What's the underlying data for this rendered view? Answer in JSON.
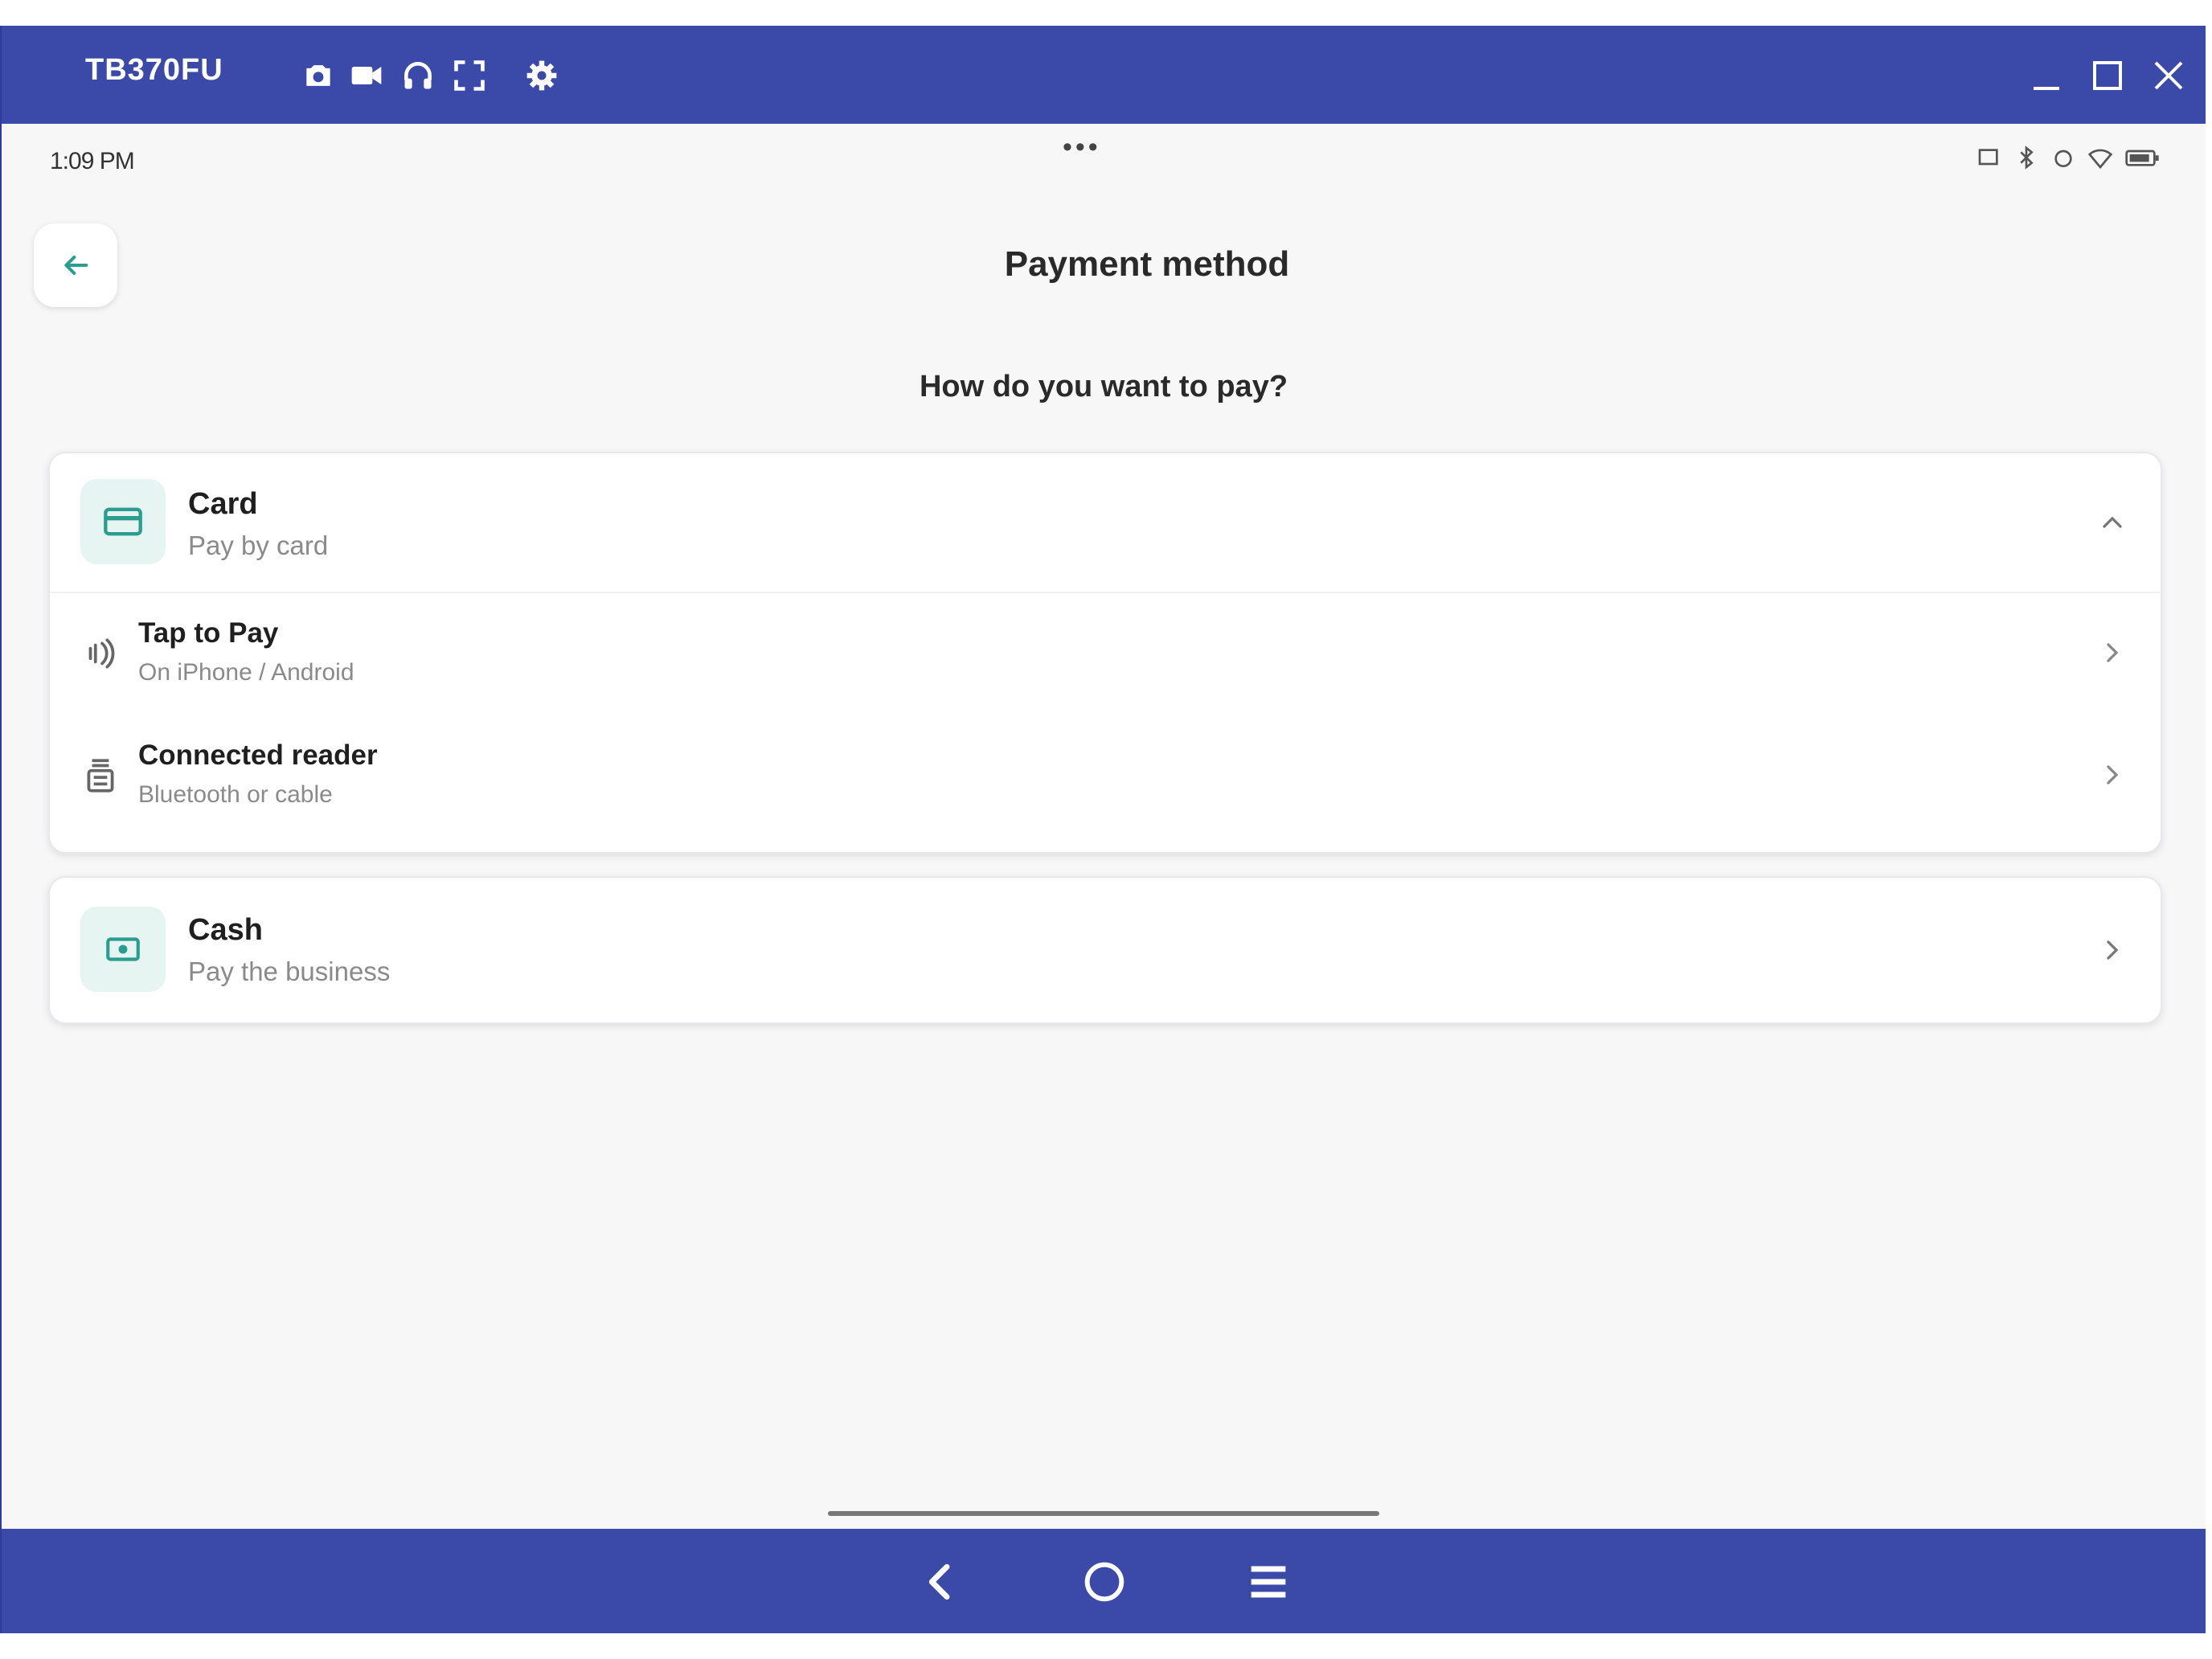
{
  "window": {
    "title": "TB370FU",
    "toolbar_icons": [
      "camera-icon",
      "video-icon",
      "headphones-icon",
      "fullscreen-icon",
      "gear-icon"
    ],
    "controls": [
      "minimize-icon",
      "maximize-icon",
      "close-icon"
    ]
  },
  "status_bar": {
    "time": "1:09 PM",
    "center": "•••"
  },
  "header": {
    "title": "Payment method"
  },
  "question": "How do you want to pay?",
  "methods": {
    "card": {
      "title": "Card",
      "subtitle": "Pay by card",
      "expanded": true,
      "options": [
        {
          "title": "Tap to Pay",
          "subtitle": "On iPhone / Android"
        },
        {
          "title": "Connected reader",
          "subtitle": "Bluetooth or cable"
        }
      ]
    },
    "cash": {
      "title": "Cash",
      "subtitle": "Pay the business"
    }
  },
  "colors": {
    "frame": "#3b4aa8",
    "accent": "#2a9d8f",
    "icon_bg": "#e6f4f2",
    "background": "#f7f7f8"
  },
  "nav": [
    "back-icon",
    "home-icon",
    "menu-icon"
  ]
}
